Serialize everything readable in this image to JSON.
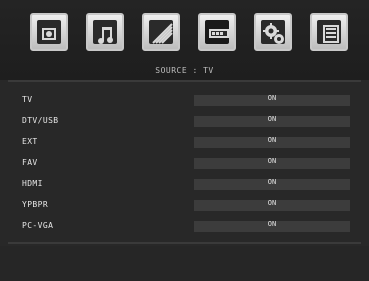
{
  "header": {
    "icons": [
      {
        "name": "picture-icon"
      },
      {
        "name": "sound-icon"
      },
      {
        "name": "feature-icon"
      },
      {
        "name": "source-icon"
      },
      {
        "name": "settings-icon"
      },
      {
        "name": "info-icon"
      }
    ],
    "source_title": "SOURCE : TV"
  },
  "menu": {
    "rows": [
      {
        "label": "TV",
        "value": "ON"
      },
      {
        "label": "DTV/USB",
        "value": "ON"
      },
      {
        "label": "EXT",
        "value": "ON"
      },
      {
        "label": "FAV",
        "value": "ON"
      },
      {
        "label": "HDMI",
        "value": "ON"
      },
      {
        "label": "YPBPR",
        "value": "ON"
      },
      {
        "label": "PC-VGA",
        "value": "ON"
      }
    ]
  },
  "colors": {
    "background": "#282828",
    "text": "#e6e6e6",
    "value_bar": "#3c3c3c"
  }
}
